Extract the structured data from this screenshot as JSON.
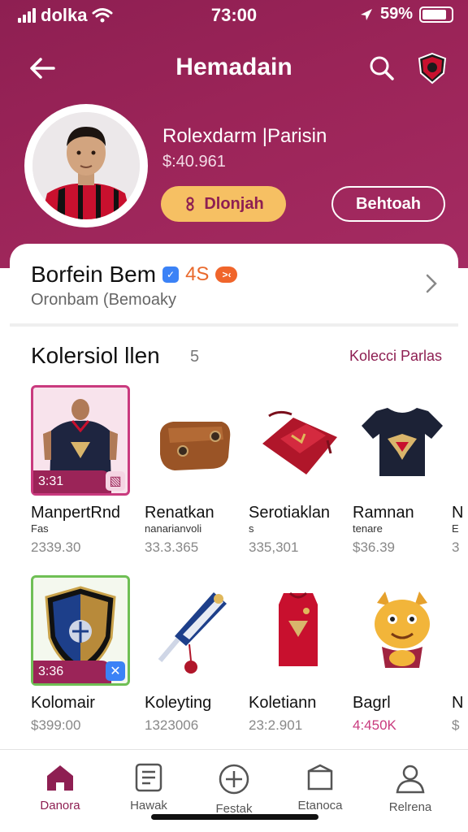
{
  "status": {
    "carrier": "dolka",
    "time": "73:00",
    "battery_text": "59%",
    "battery_level": 0.85
  },
  "header": {
    "title": "Hemadain",
    "back_icon": "back-arrow-icon",
    "search_icon": "search-icon",
    "badge_icon": "club-crest-icon"
  },
  "profile": {
    "name": "Rolexdarm |Parisin",
    "value": "$:40.961",
    "primary_button": "Dlonjah",
    "primary_icon": "infinity-icon",
    "secondary_button": "Behtoah"
  },
  "card": {
    "title": "Borfein Bem",
    "level": "4S",
    "level_tag": ">‹",
    "subtitle": "Oronbam (Bemoaky"
  },
  "section": {
    "title": "Kolersiol llen",
    "count": "5",
    "link": "Kolecci Parlas"
  },
  "items_row1": [
    {
      "name": "ManpertRnd",
      "sub": "Fas",
      "price": "2339.30",
      "badge": "3:31",
      "thumb": "player-jersey"
    },
    {
      "name": "Renatkan",
      "sub": "nanarianvoli",
      "price": "33.3.365",
      "badge": "",
      "thumb": "leather-wallet"
    },
    {
      "name": "Serotiaklan",
      "sub": "s",
      "price": "335,301",
      "badge": "",
      "thumb": "red-pouch"
    },
    {
      "name": "Ramnan",
      "sub": "tenare",
      "price": "$36.39",
      "badge": "",
      "thumb": "navy-tshirt"
    },
    {
      "name": "N",
      "sub": "E",
      "price": "3",
      "badge": "",
      "thumb": ""
    }
  ],
  "items_row2": [
    {
      "name": "Kolomair",
      "sub": "",
      "price": "$399:00",
      "badge": "3:36",
      "thumb": "club-shield"
    },
    {
      "name": "Koleyting",
      "sub": "",
      "price": "1323006",
      "badge": "",
      "thumb": "scarf-keychain"
    },
    {
      "name": "Koletiann",
      "sub": "",
      "price": "23:2.901",
      "badge": "",
      "thumb": "red-jersey"
    },
    {
      "name": "Bagrl",
      "sub": "",
      "price": "4:450K",
      "badge": "",
      "thumb": "mascot-plush"
    },
    {
      "name": "N",
      "sub": "",
      "price": "$",
      "badge": "",
      "thumb": ""
    }
  ],
  "nav": [
    {
      "label": "Danora",
      "icon": "home-icon",
      "active": true
    },
    {
      "label": "Hawak",
      "icon": "list-icon",
      "active": false
    },
    {
      "label": "Festak",
      "icon": "plus-circle-icon",
      "active": false
    },
    {
      "label": "Etanoca",
      "icon": "box-icon",
      "active": false
    },
    {
      "label": "Relrena",
      "icon": "profile-icon",
      "active": false
    }
  ],
  "colors": {
    "brand": "#8e1f52",
    "accent_yellow": "#f6c063",
    "accent_orange": "#f0652b"
  }
}
